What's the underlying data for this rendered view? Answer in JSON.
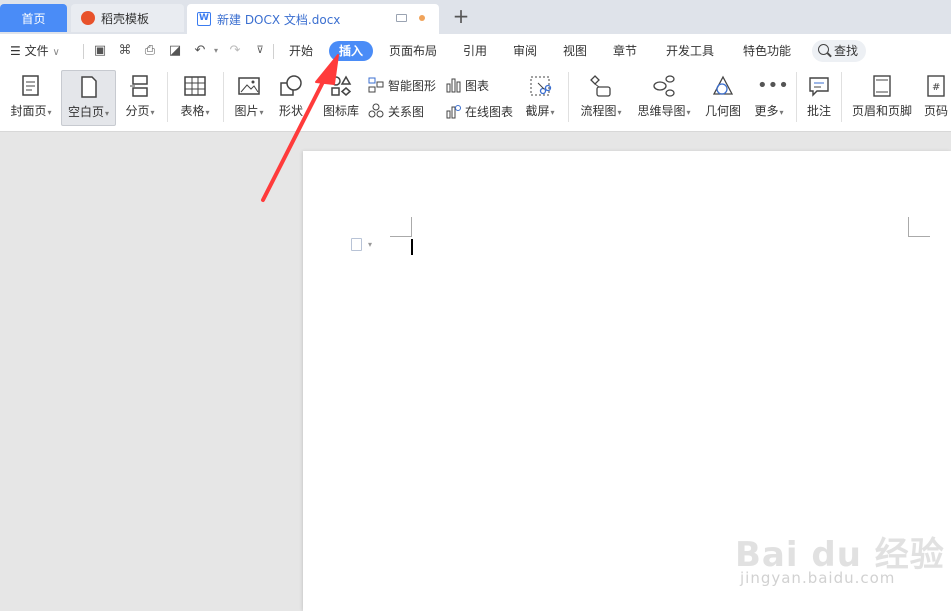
{
  "tabs": {
    "home": "首页",
    "template": "稻壳模板",
    "document": "新建 DOCX 文档.docx",
    "doc_logo_letter": "W"
  },
  "menu": {
    "file": "文件",
    "items": [
      "开始",
      "插入",
      "页面布局",
      "引用",
      "审阅",
      "视图",
      "章节",
      "开发工具",
      "特色功能"
    ],
    "active": "插入",
    "search": "查找"
  },
  "ribbon": {
    "cover_page": "封面页",
    "blank_page": "空白页",
    "page_break": "分页",
    "table": "表格",
    "picture": "图片",
    "shape": "形状",
    "icon_library": "图标库",
    "smart_art": "智能图形",
    "relation_chart": "关系图",
    "chart": "图表",
    "online_chart": "在线图表",
    "screenshot": "截屏",
    "flowchart": "流程图",
    "mind_map": "思维导图",
    "geometry": "几何图",
    "more": "更多",
    "comment": "批注",
    "header_footer": "页眉和页脚",
    "page_number": "页码"
  },
  "watermark": {
    "brand": "Bai du 经验",
    "url": "jingyan.baidu.com"
  },
  "colors": {
    "accent": "#4a8cf7",
    "arrow": "#ff3b3b",
    "flame": "#e8522b"
  }
}
